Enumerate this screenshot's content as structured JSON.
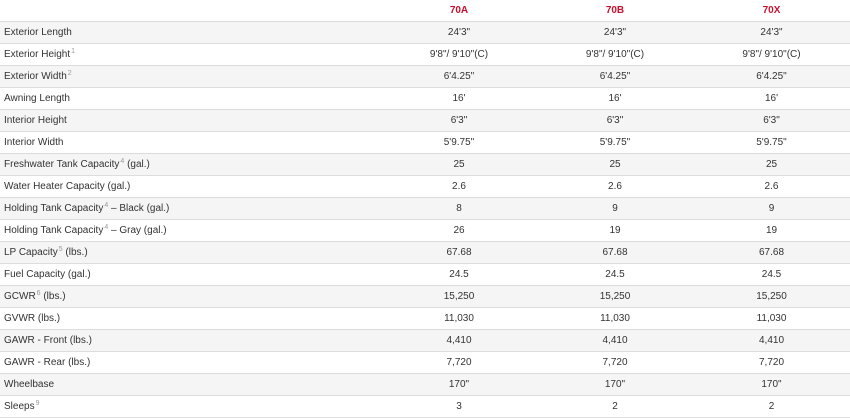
{
  "header": {
    "label_col": "",
    "models": [
      "70A",
      "70B",
      "70X"
    ]
  },
  "rows": [
    {
      "label": "Exterior Length",
      "sup": "",
      "suffix": "",
      "values": [
        "24'3\"",
        "24'3\"",
        "24'3\""
      ]
    },
    {
      "label": "Exterior Height",
      "sup": "1",
      "suffix": "",
      "values": [
        "9'8\"/ 9'10\"(C)",
        "9'8\"/ 9'10\"(C)",
        "9'8\"/ 9'10\"(C)"
      ]
    },
    {
      "label": "Exterior Width",
      "sup": "2",
      "suffix": "",
      "values": [
        "6'4.25\"",
        "6'4.25\"",
        "6'4.25\""
      ]
    },
    {
      "label": "Awning Length",
      "sup": "",
      "suffix": "",
      "values": [
        "16'",
        "16'",
        "16'"
      ]
    },
    {
      "label": "Interior Height",
      "sup": "",
      "suffix": "",
      "values": [
        "6'3\"",
        "6'3\"",
        "6'3\""
      ]
    },
    {
      "label": "Interior Width",
      "sup": "",
      "suffix": "",
      "values": [
        "5'9.75\"",
        "5'9.75\"",
        "5'9.75\""
      ]
    },
    {
      "label": "Freshwater Tank Capacity",
      "sup": "4",
      "suffix": " (gal.)",
      "values": [
        "25",
        "25",
        "25"
      ]
    },
    {
      "label": "Water Heater Capacity (gal.)",
      "sup": "",
      "suffix": "",
      "values": [
        "2.6",
        "2.6",
        "2.6"
      ]
    },
    {
      "label": "Holding Tank Capacity",
      "sup": "4",
      "suffix": " – Black (gal.)",
      "values": [
        "8",
        "9",
        "9"
      ]
    },
    {
      "label": "Holding Tank Capacity",
      "sup": "4",
      "suffix": " – Gray (gal.)",
      "values": [
        "26",
        "19",
        "19"
      ]
    },
    {
      "label": "LP Capacity",
      "sup": "5",
      "suffix": " (lbs.)",
      "values": [
        "67.68",
        "67.68",
        "67.68"
      ]
    },
    {
      "label": "Fuel Capacity (gal.)",
      "sup": "",
      "suffix": "",
      "values": [
        "24.5",
        "24.5",
        "24.5"
      ]
    },
    {
      "label": "GCWR",
      "sup": "6",
      "suffix": " (lbs.)",
      "values": [
        "15,250",
        "15,250",
        "15,250"
      ]
    },
    {
      "label": "GVWR (lbs.)",
      "sup": "",
      "suffix": "",
      "values": [
        "11,030",
        "11,030",
        "11,030"
      ]
    },
    {
      "label": "GAWR - Front (lbs.)",
      "sup": "",
      "suffix": "",
      "values": [
        "4,410",
        "4,410",
        "4,410"
      ]
    },
    {
      "label": "GAWR - Rear (lbs.)",
      "sup": "",
      "suffix": "",
      "values": [
        "7,720",
        "7,720",
        "7,720"
      ]
    },
    {
      "label": "Wheelbase",
      "sup": "",
      "suffix": "",
      "values": [
        "170\"",
        "170\"",
        "170\""
      ]
    },
    {
      "label": "Sleeps",
      "sup": "9",
      "suffix": "",
      "values": [
        "3",
        "2",
        "2"
      ]
    }
  ],
  "colors": {
    "model_header": "#c8102e",
    "row_stripe": "#f5f5f5",
    "text": "#333333",
    "footnote": "#999999",
    "divider": "#dddddd"
  }
}
